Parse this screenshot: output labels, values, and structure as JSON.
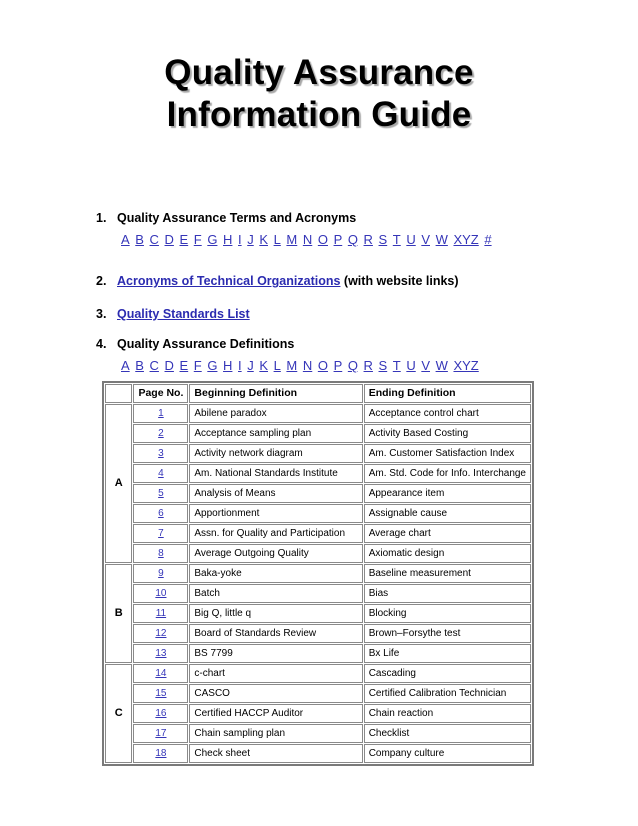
{
  "title": {
    "line1": "Quality Assurance",
    "line2": "Information Guide"
  },
  "sections": [
    {
      "number": "1.",
      "label": "Quality Assurance Terms and Acronyms",
      "letters": [
        "A",
        "B",
        "C",
        "D",
        "E",
        "F",
        "G",
        "H",
        "I",
        "J",
        "K",
        "L",
        "M",
        "N",
        "O",
        "P",
        "Q",
        "R",
        "S",
        "T",
        "U",
        "V",
        "W",
        "XYZ",
        "#"
      ]
    },
    {
      "number": "2.",
      "link_label": "Acronyms of Technical Organizations",
      "suffix": "(with website links)"
    },
    {
      "number": "3.",
      "link_label": "Quality Standards List"
    },
    {
      "number": "4.",
      "label": "Quality Assurance Definitions",
      "letters": [
        "A",
        "B",
        "C",
        "D",
        "E",
        "F",
        "G",
        "H",
        "I",
        "J",
        "K",
        "L",
        "M",
        "N",
        "O",
        "P",
        "Q",
        "R",
        "S",
        "T",
        "U",
        "V",
        "W",
        "XYZ"
      ]
    }
  ],
  "table": {
    "headers": [
      "",
      "Page No.",
      "Beginning Definition",
      "Ending Definition"
    ],
    "groups": [
      {
        "letter": "A",
        "rows": [
          {
            "page": "1",
            "begin": "Abilene paradox",
            "end": "Acceptance control chart"
          },
          {
            "page": "2",
            "begin": "Acceptance sampling plan",
            "end": "Activity Based Costing"
          },
          {
            "page": "3",
            "begin": "Activity network diagram",
            "end": "Am. Customer Satisfaction Index"
          },
          {
            "page": "4",
            "begin": "Am. National Standards Institute",
            "end": "Am. Std. Code for Info. Interchange"
          },
          {
            "page": "5",
            "begin": "Analysis of Means",
            "end": "Appearance item"
          },
          {
            "page": "6",
            "begin": "Apportionment",
            "end": "Assignable cause"
          },
          {
            "page": "7",
            "begin": "Assn. for Quality and Participation",
            "end": "Average chart"
          },
          {
            "page": "8",
            "begin": "Average Outgoing Quality",
            "end": "Axiomatic design"
          }
        ]
      },
      {
        "letter": "B",
        "rows": [
          {
            "page": "9",
            "begin": "Baka-yoke",
            "end": "Baseline measurement"
          },
          {
            "page": "10",
            "begin": "Batch",
            "end": "Bias"
          },
          {
            "page": "11",
            "begin": "Big Q, little q",
            "end": "Blocking"
          },
          {
            "page": "12",
            "begin": "Board of Standards Review",
            "end": "Brown–Forsythe test"
          },
          {
            "page": "13",
            "begin": "BS 7799",
            "end": "Bx Life"
          }
        ]
      },
      {
        "letter": "C",
        "rows": [
          {
            "page": "14",
            "begin": "c-chart",
            "end": "Cascading"
          },
          {
            "page": "15",
            "begin": "CASCO",
            "end": "Certified Calibration Technician"
          },
          {
            "page": "16",
            "begin": "Certified HACCP Auditor",
            "end": "Chain reaction"
          },
          {
            "page": "17",
            "begin": "Chain sampling plan",
            "end": "Checklist"
          },
          {
            "page": "18",
            "begin": "Check sheet",
            "end": "Company culture"
          }
        ]
      }
    ]
  },
  "colors": {
    "link": "#2b2bb0",
    "title_shadow": "#a8a8a8",
    "table_border": "#8a8a8a"
  }
}
